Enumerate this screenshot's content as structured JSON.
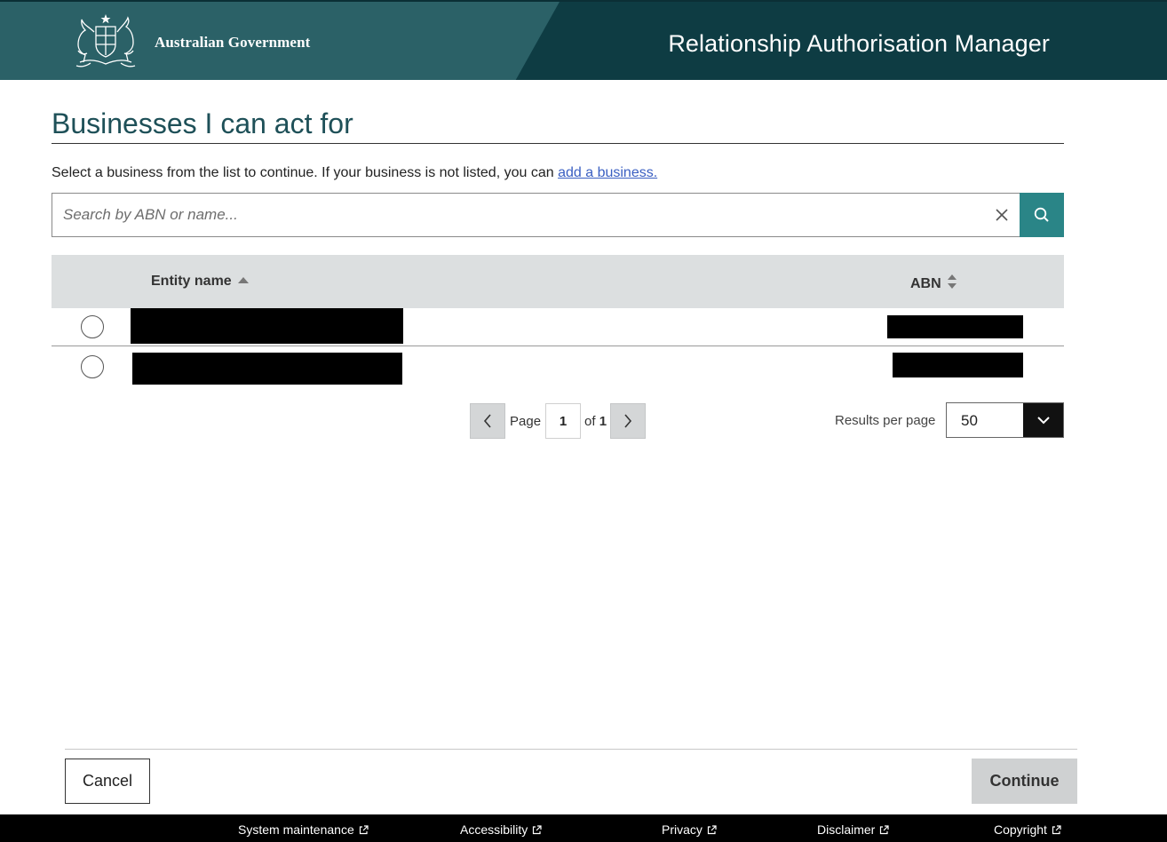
{
  "header": {
    "brand": "Australian Government",
    "app_title": "Relationship Authorisation Manager"
  },
  "page": {
    "title": "Businesses I can act for",
    "intro_text": "Select a business from the list to continue. If your business is not listed, you can ",
    "intro_link": "add a business."
  },
  "search": {
    "placeholder": "Search by ABN or name...",
    "value": ""
  },
  "table": {
    "columns": [
      "Entity name",
      "ABN"
    ],
    "rows": [
      {
        "entity_name": "",
        "abn": "",
        "redacted": true
      },
      {
        "entity_name": "",
        "abn": "",
        "redacted": true
      }
    ]
  },
  "pagination": {
    "page_label": "Page",
    "current_page": "1",
    "of_label": "of",
    "total_pages": "1",
    "results_label": "Results per page",
    "results_per_page": "50"
  },
  "actions": {
    "cancel_label": "Cancel",
    "continue_label": "Continue"
  },
  "footer_links": [
    "System maintenance",
    "Accessibility",
    "Privacy",
    "Disclaimer",
    "Copyright"
  ],
  "colors": {
    "header_dark": "#0e3c43",
    "header_band": "#2b6167",
    "title_teal": "#1e5058",
    "search_button": "#2a8587",
    "link_blue": "#3a5fc2",
    "table_header": "#dcdfe0",
    "continue_disabled": "#cfd1d2"
  },
  "icons": {
    "crest": "coat-of-arms-icon",
    "clear": "close-icon",
    "search": "search-icon",
    "sort_asc": "sort-up-icon",
    "sort_both": "sort-both-icon",
    "prev": "chevron-left-icon",
    "next": "chevron-right-icon",
    "dropdown": "chevron-down-icon",
    "external": "external-link-icon"
  }
}
